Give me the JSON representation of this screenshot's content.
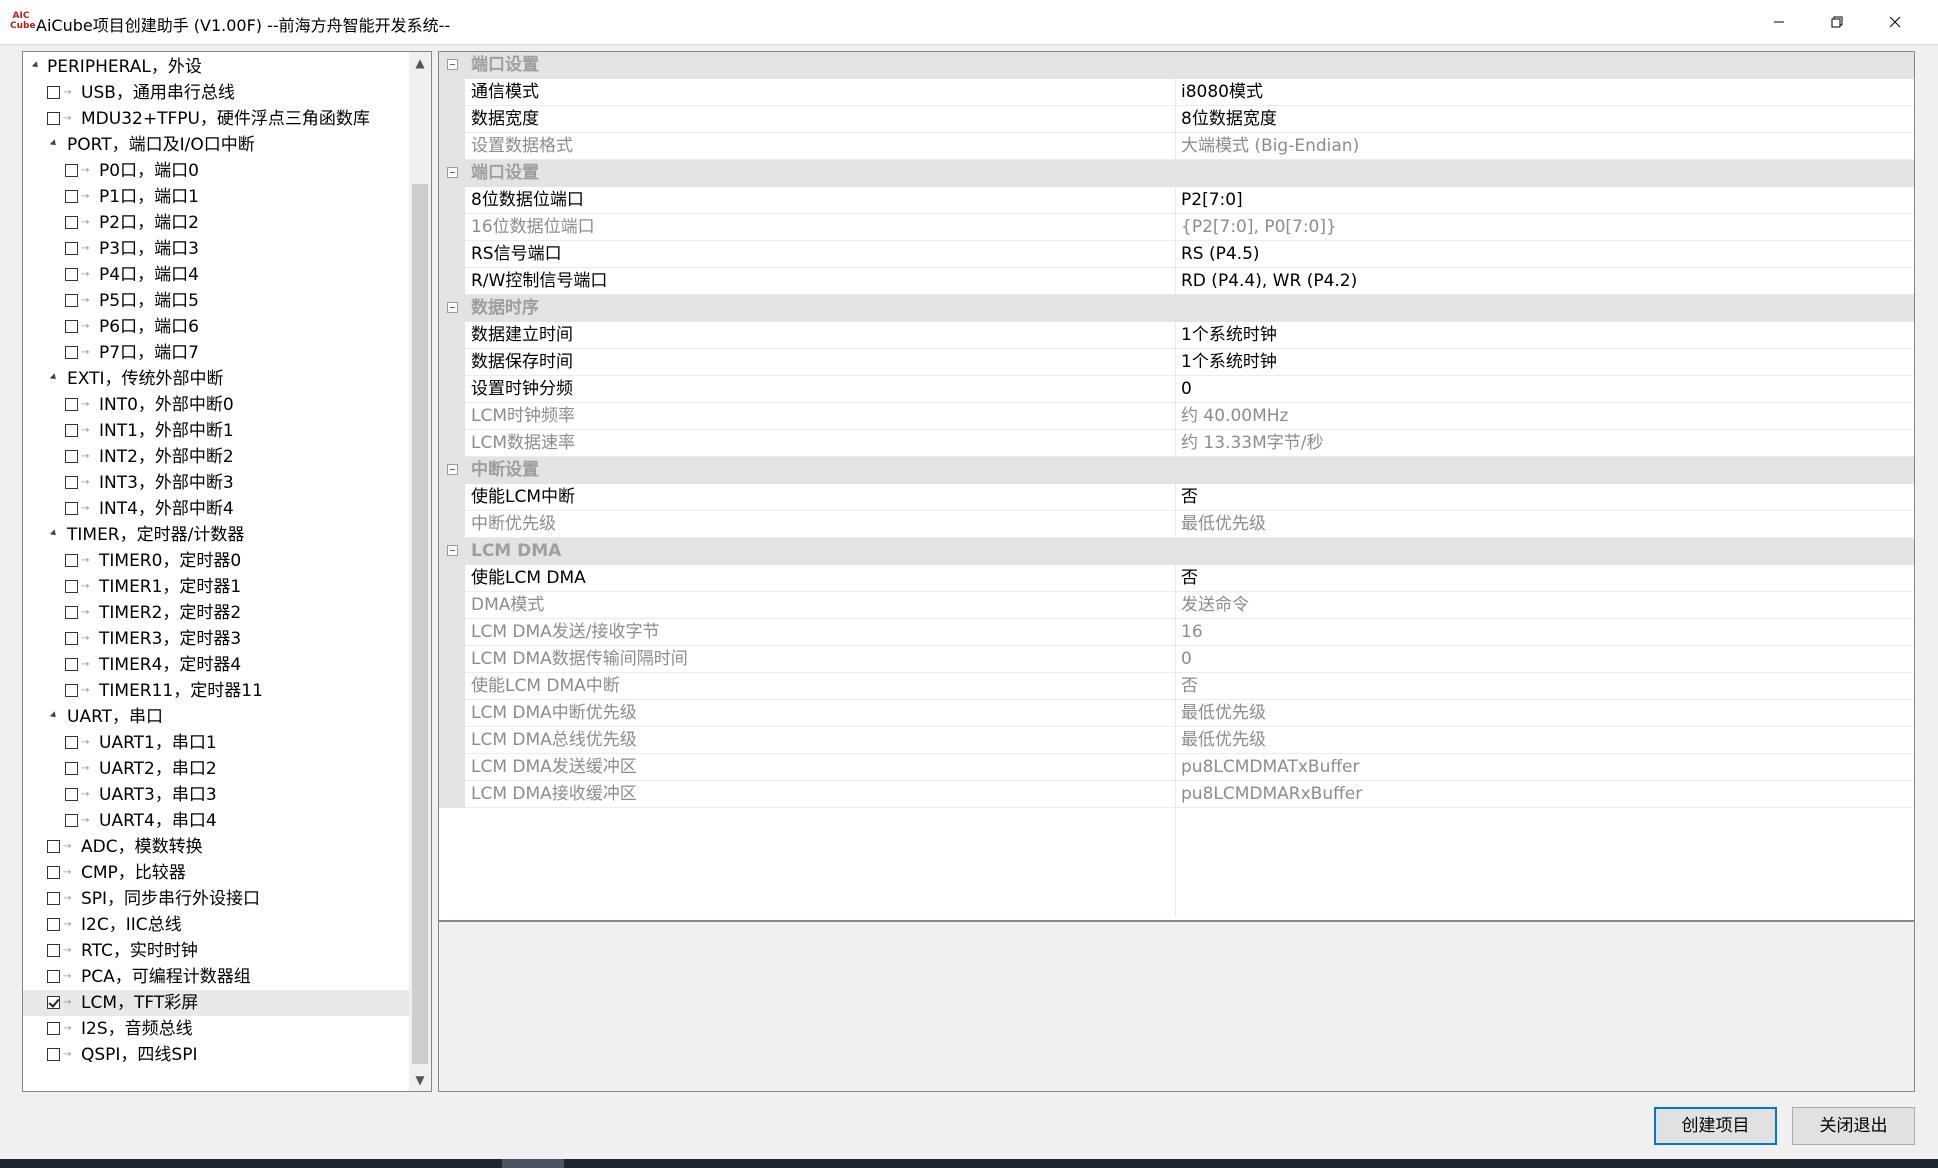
{
  "window": {
    "title": "AiCube项目创建助手 (V1.00F) --前海方舟智能开发系统--",
    "icon_top": "AIC",
    "icon_bottom": "Cube"
  },
  "tree": {
    "items": [
      {
        "label": "PERIPHERAL，外设",
        "level": 0,
        "type": "group"
      },
      {
        "label": "USB，通用串行总线",
        "level": 1,
        "type": "leaf",
        "checked": false
      },
      {
        "label": "MDU32+TFPU，硬件浮点三角函数库",
        "level": 1,
        "type": "leaf",
        "checked": false
      },
      {
        "label": "PORT，端口及I/O口中断",
        "level": 1,
        "type": "group"
      },
      {
        "label": "P0口，端口0",
        "level": 2,
        "type": "leaf",
        "checked": false
      },
      {
        "label": "P1口，端口1",
        "level": 2,
        "type": "leaf",
        "checked": false
      },
      {
        "label": "P2口，端口2",
        "level": 2,
        "type": "leaf",
        "checked": false
      },
      {
        "label": "P3口，端口3",
        "level": 2,
        "type": "leaf",
        "checked": false
      },
      {
        "label": "P4口，端口4",
        "level": 2,
        "type": "leaf",
        "checked": false
      },
      {
        "label": "P5口，端口5",
        "level": 2,
        "type": "leaf",
        "checked": false
      },
      {
        "label": "P6口，端口6",
        "level": 2,
        "type": "leaf",
        "checked": false
      },
      {
        "label": "P7口，端口7",
        "level": 2,
        "type": "leaf",
        "checked": false
      },
      {
        "label": "EXTI，传统外部中断",
        "level": 1,
        "type": "group"
      },
      {
        "label": "INT0，外部中断0",
        "level": 2,
        "type": "leaf",
        "checked": false
      },
      {
        "label": "INT1，外部中断1",
        "level": 2,
        "type": "leaf",
        "checked": false
      },
      {
        "label": "INT2，外部中断2",
        "level": 2,
        "type": "leaf",
        "checked": false
      },
      {
        "label": "INT3，外部中断3",
        "level": 2,
        "type": "leaf",
        "checked": false
      },
      {
        "label": "INT4，外部中断4",
        "level": 2,
        "type": "leaf",
        "checked": false
      },
      {
        "label": "TIMER，定时器/计数器",
        "level": 1,
        "type": "group"
      },
      {
        "label": "TIMER0，定时器0",
        "level": 2,
        "type": "leaf",
        "checked": false
      },
      {
        "label": "TIMER1，定时器1",
        "level": 2,
        "type": "leaf",
        "checked": false
      },
      {
        "label": "TIMER2，定时器2",
        "level": 2,
        "type": "leaf",
        "checked": false
      },
      {
        "label": "TIMER3，定时器3",
        "level": 2,
        "type": "leaf",
        "checked": false
      },
      {
        "label": "TIMER4，定时器4",
        "level": 2,
        "type": "leaf",
        "checked": false
      },
      {
        "label": "TIMER11，定时器11",
        "level": 2,
        "type": "leaf",
        "checked": false
      },
      {
        "label": "UART，串口",
        "level": 1,
        "type": "group"
      },
      {
        "label": "UART1，串口1",
        "level": 2,
        "type": "leaf",
        "checked": false
      },
      {
        "label": "UART2，串口2",
        "level": 2,
        "type": "leaf",
        "checked": false
      },
      {
        "label": "UART3，串口3",
        "level": 2,
        "type": "leaf",
        "checked": false
      },
      {
        "label": "UART4，串口4",
        "level": 2,
        "type": "leaf",
        "checked": false
      },
      {
        "label": "ADC，模数转换",
        "level": 1,
        "type": "leaf",
        "checked": false
      },
      {
        "label": "CMP，比较器",
        "level": 1,
        "type": "leaf",
        "checked": false
      },
      {
        "label": "SPI，同步串行外设接口",
        "level": 1,
        "type": "leaf",
        "checked": false
      },
      {
        "label": "I2C，IIC总线",
        "level": 1,
        "type": "leaf",
        "checked": false
      },
      {
        "label": "RTC，实时时钟",
        "level": 1,
        "type": "leaf",
        "checked": false
      },
      {
        "label": "PCA，可编程计数器组",
        "level": 1,
        "type": "leaf",
        "checked": false
      },
      {
        "label": "LCM，TFT彩屏",
        "level": 1,
        "type": "leaf",
        "checked": true,
        "selected": true
      },
      {
        "label": "I2S，音频总线",
        "level": 1,
        "type": "leaf",
        "checked": false
      },
      {
        "label": "QSPI，四线SPI",
        "level": 1,
        "type": "leaf",
        "checked": false
      }
    ]
  },
  "property_grid": {
    "rows": [
      {
        "kind": "category",
        "label": "端口设置"
      },
      {
        "kind": "prop",
        "name": "通信模式",
        "value": "i8080模式",
        "enabled": true
      },
      {
        "kind": "prop",
        "name": "数据宽度",
        "value": "8位数据宽度",
        "enabled": true
      },
      {
        "kind": "prop",
        "name": "设置数据格式",
        "value": "大端模式 (Big-Endian)",
        "enabled": false
      },
      {
        "kind": "category",
        "label": "端口设置"
      },
      {
        "kind": "prop",
        "name": "8位数据位端口",
        "value": "P2[7:0]",
        "enabled": true
      },
      {
        "kind": "prop",
        "name": "16位数据位端口",
        "value": "{P2[7:0], P0[7:0]}",
        "enabled": false
      },
      {
        "kind": "prop",
        "name": "RS信号端口",
        "value": "RS (P4.5)",
        "enabled": true
      },
      {
        "kind": "prop",
        "name": "R/W控制信号端口",
        "value": "RD (P4.4), WR (P4.2)",
        "enabled": true
      },
      {
        "kind": "category",
        "label": "数据时序"
      },
      {
        "kind": "prop",
        "name": "数据建立时间",
        "value": "1个系统时钟",
        "enabled": true
      },
      {
        "kind": "prop",
        "name": "数据保存时间",
        "value": "1个系统时钟",
        "enabled": true
      },
      {
        "kind": "prop",
        "name": "设置时钟分频",
        "value": "0",
        "enabled": true
      },
      {
        "kind": "prop",
        "name": "LCM时钟频率",
        "value": "约 40.00MHz",
        "enabled": false
      },
      {
        "kind": "prop",
        "name": "LCM数据速率",
        "value": "约 13.33M字节/秒",
        "enabled": false
      },
      {
        "kind": "category",
        "label": "中断设置"
      },
      {
        "kind": "prop",
        "name": "使能LCM中断",
        "value": "否",
        "enabled": true
      },
      {
        "kind": "prop",
        "name": "中断优先级",
        "value": "最低优先级",
        "enabled": false
      },
      {
        "kind": "category",
        "label": "LCM DMA"
      },
      {
        "kind": "prop",
        "name": "使能LCM DMA",
        "value": "否",
        "enabled": true
      },
      {
        "kind": "prop",
        "name": "DMA模式",
        "value": "发送命令",
        "enabled": false
      },
      {
        "kind": "prop",
        "name": "LCM DMA发送/接收字节",
        "value": "16",
        "enabled": false
      },
      {
        "kind": "prop",
        "name": "LCM DMA数据传输间隔时间",
        "value": "0",
        "enabled": false
      },
      {
        "kind": "prop",
        "name": "使能LCM DMA中断",
        "value": "否",
        "enabled": false
      },
      {
        "kind": "prop",
        "name": "LCM DMA中断优先级",
        "value": "最低优先级",
        "enabled": false
      },
      {
        "kind": "prop",
        "name": "LCM DMA总线优先级",
        "value": "最低优先级",
        "enabled": false
      },
      {
        "kind": "prop",
        "name": "LCM DMA发送缓冲区",
        "value": "pu8LCMDMATxBuffer",
        "enabled": false
      },
      {
        "kind": "prop",
        "name": "LCM DMA接收缓冲区",
        "value": "pu8LCMDMARxBuffer",
        "enabled": false
      }
    ]
  },
  "buttons": {
    "create": "创建项目",
    "exit": "关闭退出"
  },
  "icons": {
    "minimize": "minimize-icon",
    "maximize": "restore-icon",
    "close": "close-icon"
  }
}
